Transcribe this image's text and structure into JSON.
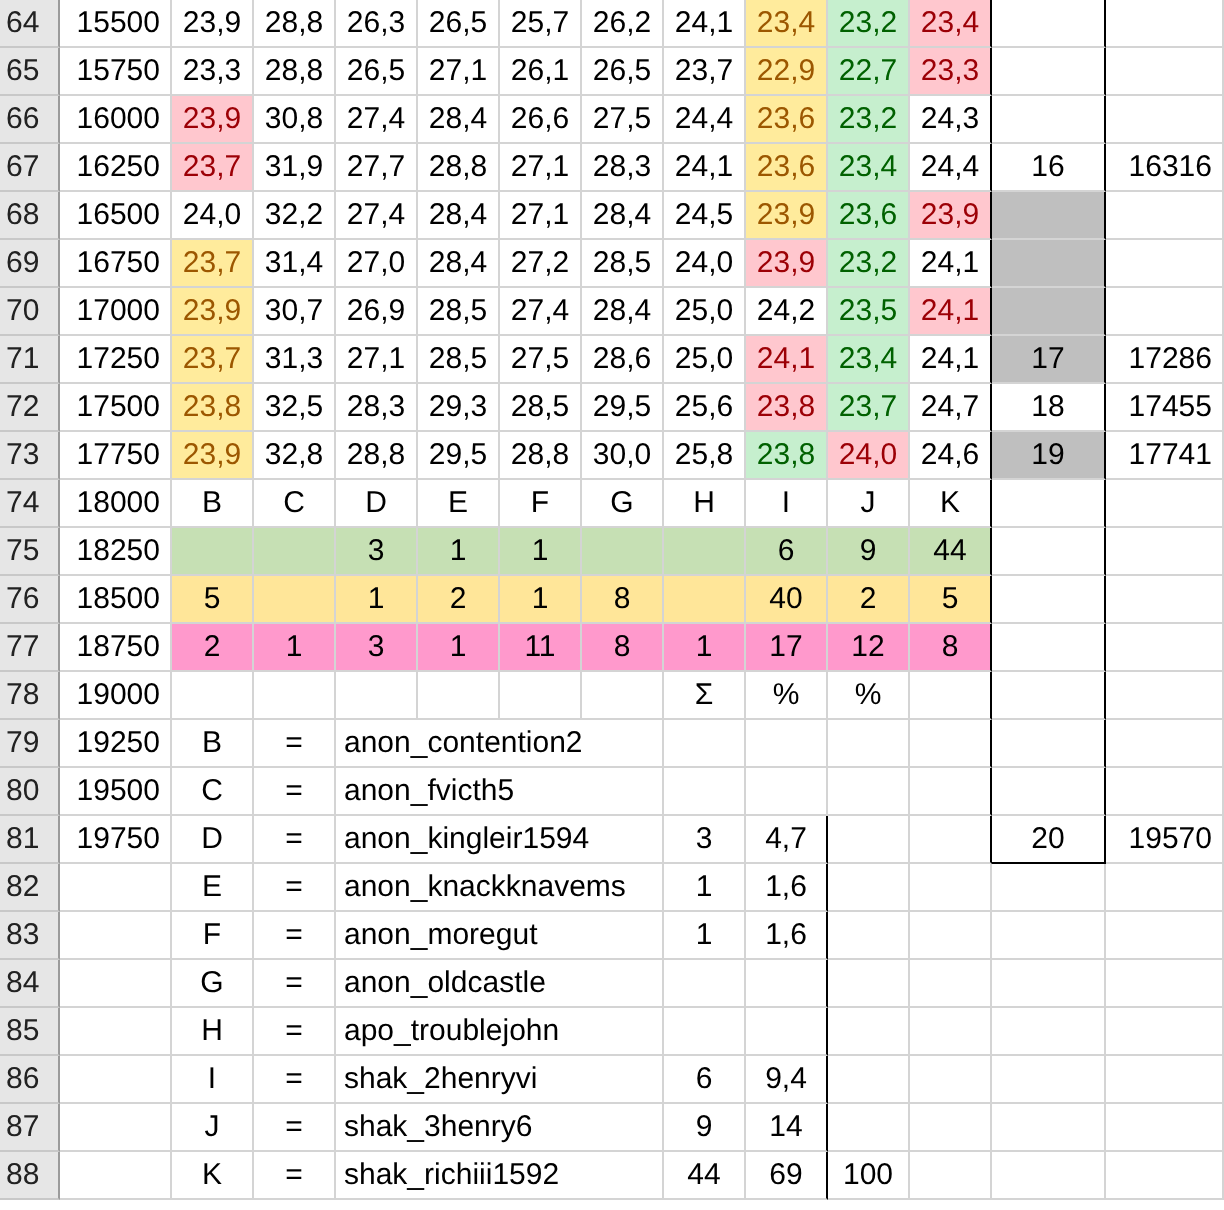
{
  "rows": [
    {
      "number": "64",
      "cells": [
        "15500",
        "23,9",
        "28,8",
        "26,3",
        "26,5",
        "25,7",
        "26,2",
        "24,1",
        {
          "text": "23,4",
          "color": "#ffeb9c"
        },
        {
          "text": "23,2",
          "color": "#c6efce"
        },
        {
          "text": "23,4",
          "color": "#ffc7ce"
        },
        null,
        null
      ]
    },
    {
      "number": "65",
      "cells": [
        "15750",
        "23,3",
        "28,8",
        "26,5",
        "27,1",
        "26,1",
        "26,5",
        "23,7",
        {
          "text": "22,9",
          "color": "#ffeb9c"
        },
        {
          "text": "22,7",
          "color": "#c6efce"
        },
        {
          "text": "23,3",
          "color": "#ffc7ce"
        },
        null,
        null
      ]
    },
    {
      "number": "66",
      "cells": [
        "16000",
        {
          "text": "23,9",
          "color": "#ffc7ce"
        },
        "30,8",
        "27,4",
        "28,4",
        "26,6",
        "27,5",
        "24,4",
        {
          "text": "23,6",
          "color": "#ffeb9c"
        },
        {
          "text": "23,2",
          "color": "#c6efce"
        },
        "24,3",
        null,
        null
      ]
    },
    {
      "number": "67",
      "cells": [
        "16250",
        {
          "text": "23,7",
          "color": "#ffc7ce"
        },
        "31,9",
        "27,7",
        "28,8",
        "27,1",
        "28,3",
        "24,1",
        {
          "text": "23,6",
          "color": "#ffeb9c"
        },
        {
          "text": "23,4",
          "color": "#c6efce"
        },
        "24,4",
        "16",
        "16316"
      ]
    },
    {
      "number": "68",
      "cells": [
        "16500",
        "24,0",
        "32,2",
        "27,4",
        "28,4",
        "27,1",
        "28,4",
        "24,5",
        {
          "text": "23,9",
          "color": "#ffeb9c"
        },
        {
          "text": "23,6",
          "color": "#c6efce"
        },
        {
          "text": "23,9",
          "color": "#ffc7ce"
        },
        {
          "color": "#bfbfbf"
        },
        null
      ]
    },
    {
      "number": "69",
      "cells": [
        "16750",
        {
          "text": "23,7",
          "color": "#ffeb9c"
        },
        "31,4",
        "27,0",
        "28,4",
        "27,2",
        "28,5",
        "24,0",
        {
          "text": "23,9",
          "color": "#ffc7ce"
        },
        {
          "text": "23,2",
          "color": "#c6efce"
        },
        "24,1",
        {
          "color": "#bfbfbf"
        },
        null
      ]
    },
    {
      "number": "70",
      "cells": [
        "17000",
        {
          "text": "23,9",
          "color": "#ffeb9c"
        },
        "30,7",
        "26,9",
        "28,5",
        "27,4",
        "28,4",
        "25,0",
        "24,2",
        {
          "text": "23,5",
          "color": "#c6efce"
        },
        {
          "text": "24,1",
          "color": "#ffc7ce"
        },
        {
          "color": "#bfbfbf"
        },
        null
      ]
    },
    {
      "number": "71",
      "cells": [
        "17250",
        {
          "text": "23,7",
          "color": "#ffeb9c"
        },
        "31,3",
        "27,1",
        "28,5",
        "27,5",
        "28,6",
        "25,0",
        {
          "text": "24,1",
          "color": "#ffc7ce"
        },
        {
          "text": "23,4",
          "color": "#c6efce"
        },
        "24,1",
        {
          "text": "17",
          "color": "#bfbfbf"
        },
        "17286"
      ]
    },
    {
      "number": "72",
      "cells": [
        "17500",
        {
          "text": "23,8",
          "color": "#ffeb9c"
        },
        "32,5",
        "28,3",
        "29,3",
        "28,5",
        "29,5",
        "25,6",
        {
          "text": "23,8",
          "color": "#ffc7ce"
        },
        {
          "text": "23,7",
          "color": "#c6efce"
        },
        "24,7",
        "18",
        "17455"
      ]
    },
    {
      "number": "73",
      "cells": [
        "17750",
        {
          "text": "23,9",
          "color": "#ffeb9c"
        },
        "32,8",
        "28,8",
        "29,5",
        "28,8",
        "30,0",
        "25,8",
        {
          "text": "23,8",
          "color": "#c6efce"
        },
        {
          "text": "24,0",
          "color": "#ffc7ce"
        },
        "24,6",
        {
          "text": "19",
          "color": "#bfbfbf"
        },
        "17741"
      ]
    },
    {
      "number": "74",
      "cells": [
        "18000",
        "B",
        "C",
        "D",
        "E",
        "F",
        "G",
        "H",
        "I",
        "J",
        "K",
        null,
        null
      ]
    },
    {
      "number": "75",
      "color": "#c6e0b4",
      "cells": [
        "18250",
        null,
        null,
        "3",
        "1",
        "1",
        null,
        null,
        "6",
        "9",
        "44",
        null,
        null
      ]
    },
    {
      "number": "76",
      "color": "#ffe699",
      "cells": [
        "18500",
        "5",
        null,
        "1",
        "2",
        "1",
        "8",
        null,
        "40",
        "2",
        "5",
        null,
        null
      ]
    },
    {
      "number": "77",
      "color": "#ff99cc",
      "cells": [
        "18750",
        "2",
        "1",
        "3",
        "1",
        "11",
        "8",
        "1",
        "17",
        "12",
        "8",
        null,
        null
      ]
    },
    {
      "number": "78",
      "cells": [
        "19000",
        null,
        null,
        null,
        null,
        null,
        null,
        "Σ",
        "%",
        "%",
        null,
        null,
        null
      ]
    },
    {
      "number": "79",
      "cells": [
        "19250",
        "B",
        "=",
        {
          "text": "anon_contention2",
          "kind": "name"
        },
        null,
        null,
        null,
        null,
        null,
        null,
        null,
        null,
        null
      ]
    },
    {
      "number": "80",
      "cells": [
        "19500",
        "C",
        "=",
        {
          "text": "anon_fvicth5",
          "kind": "name"
        },
        null,
        null,
        null,
        null,
        null,
        null,
        null,
        null,
        null
      ]
    },
    {
      "number": "81",
      "cells": [
        "19750",
        "D",
        "=",
        {
          "text": "anon_kingleir1594",
          "kind": "name"
        },
        null,
        null,
        null,
        "3",
        "4,7",
        null,
        null,
        "20",
        "19570"
      ]
    },
    {
      "number": "82",
      "cells": [
        null,
        "E",
        "=",
        {
          "text": "anon_knackknavems",
          "kind": "name"
        },
        null,
        null,
        null,
        "1",
        "1,6",
        null,
        null,
        null,
        null
      ]
    },
    {
      "number": "83",
      "cells": [
        null,
        "F",
        "=",
        {
          "text": "anon_moregut",
          "kind": "name"
        },
        null,
        null,
        null,
        "1",
        "1,6",
        null,
        null,
        null,
        null
      ]
    },
    {
      "number": "84",
      "cells": [
        null,
        "G",
        "=",
        {
          "text": "anon_oldcastle",
          "kind": "name"
        },
        null,
        null,
        null,
        null,
        null,
        null,
        null,
        null,
        null
      ]
    },
    {
      "number": "85",
      "cells": [
        null,
        "H",
        "=",
        {
          "text": "apo_troublejohn",
          "kind": "name"
        },
        null,
        null,
        null,
        null,
        null,
        null,
        null,
        null,
        null
      ]
    },
    {
      "number": "86",
      "cells": [
        null,
        "I",
        "=",
        {
          "text": "shak_2henryvi",
          "kind": "name"
        },
        null,
        null,
        null,
        "6",
        "9,4",
        null,
        null,
        null,
        null
      ]
    },
    {
      "number": "87",
      "cells": [
        null,
        "J",
        "=",
        {
          "text": "shak_3henry6",
          "kind": "name"
        },
        null,
        null,
        null,
        "9",
        "14",
        null,
        null,
        null,
        null
      ]
    },
    {
      "number": "88",
      "cells": [
        null,
        "K",
        "=",
        {
          "text": "shak_richiii1592",
          "kind": "name"
        },
        null,
        null,
        null,
        "44",
        "69",
        "100",
        null,
        null,
        null
      ]
    }
  ]
}
